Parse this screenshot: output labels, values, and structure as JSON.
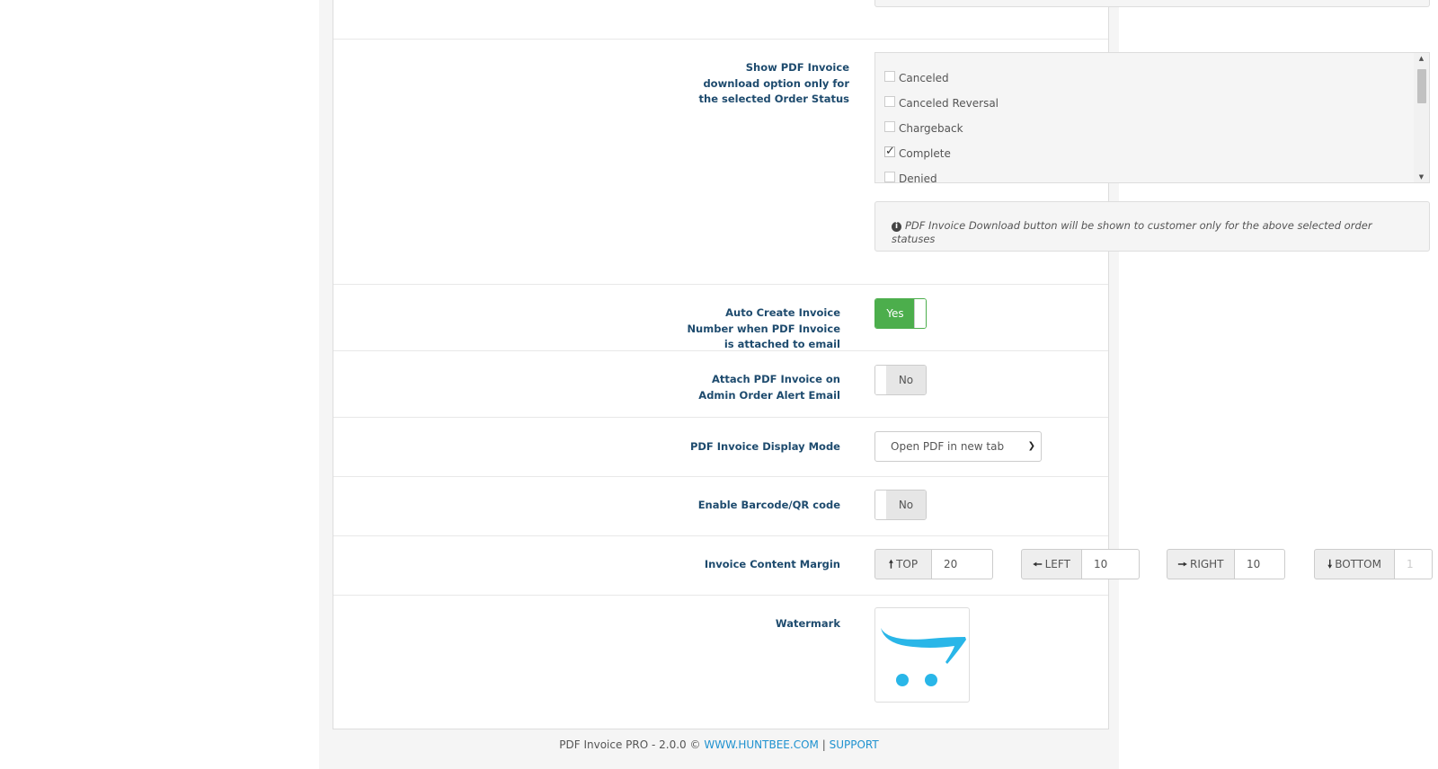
{
  "order_status": {
    "label": "Show PDF Invoice download option only for the selected Order Status",
    "items": [
      {
        "label": "Canceled",
        "checked": false
      },
      {
        "label": "Canceled Reversal",
        "checked": false
      },
      {
        "label": "Chargeback",
        "checked": false
      },
      {
        "label": "Complete",
        "checked": true
      },
      {
        "label": "Denied",
        "checked": false
      }
    ],
    "help": "PDF Invoice Download button will be shown to customer only for the above selected order statuses"
  },
  "auto_create": {
    "label": "Auto Create Invoice Number when PDF Invoice is attached to email",
    "state": "Yes",
    "color_on": "#4cae4c"
  },
  "attach_admin": {
    "label": "Attach PDF Invoice on Admin Order Alert Email",
    "state": "No"
  },
  "display_mode": {
    "label": "PDF Invoice Display Mode",
    "selected": "Open PDF in new tab"
  },
  "barcode": {
    "label": "Enable Barcode/QR code",
    "state": "No"
  },
  "margin": {
    "label": "Invoice Content Margin",
    "top": {
      "label": "TOP",
      "value": "20"
    },
    "left": {
      "label": "LEFT",
      "value": "10"
    },
    "right": {
      "label": "RIGHT",
      "value": "10"
    },
    "bottom": {
      "label": "BOTTOM",
      "value": "1"
    }
  },
  "watermark": {
    "label": "Watermark",
    "icon": "opencart-cart-icon",
    "color": "#29b6e8"
  },
  "footer": {
    "text": "PDF Invoice PRO - 2.0.0 ©",
    "link1": "WWW.HUNTBEE.COM",
    "sep": "|",
    "link2": "SUPPORT"
  }
}
